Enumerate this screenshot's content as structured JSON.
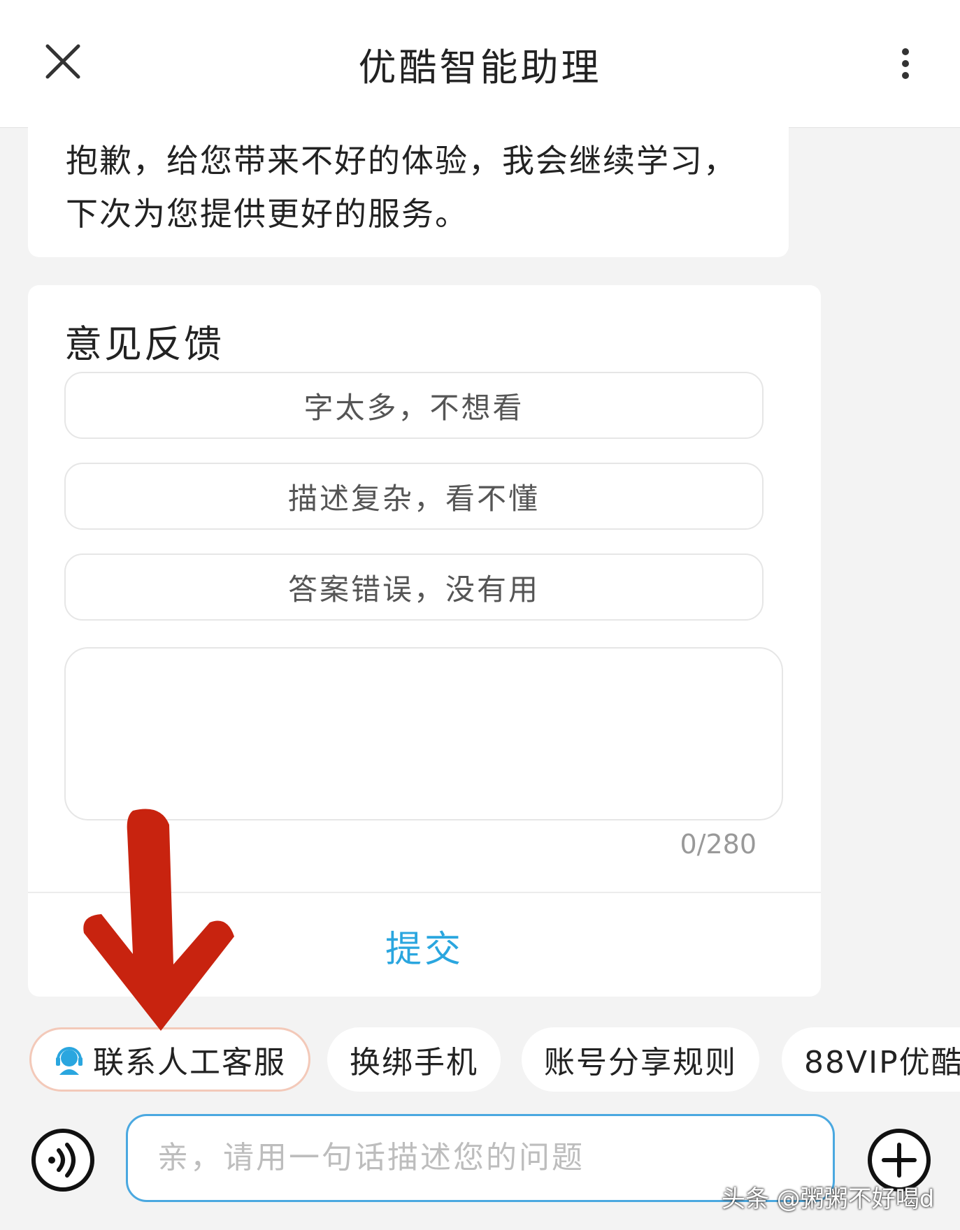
{
  "header": {
    "title": "优酷智能助理"
  },
  "apology": {
    "text": "抱歉，给您带来不好的体验，我会继续学习，下次为您提供更好的服务。"
  },
  "feedback": {
    "title": "意见反馈",
    "options": [
      "字太多，不想看",
      "描述复杂，看不懂",
      "答案错误，没有用"
    ],
    "counter": "0/280",
    "submit_label": "提交"
  },
  "quick_actions": [
    "联系人工客服",
    "换绑手机",
    "账号分享规则",
    "88VIP优酷"
  ],
  "input": {
    "placeholder": "亲，请用一句话描述您的问题"
  },
  "watermark": "头条 @粥粥不好喝d",
  "colors": {
    "accent": "#2aa6df",
    "input_border": "#4aa8e0",
    "annotation_arrow": "#c8230f",
    "chip_highlight_border": "#f3c9b9"
  }
}
